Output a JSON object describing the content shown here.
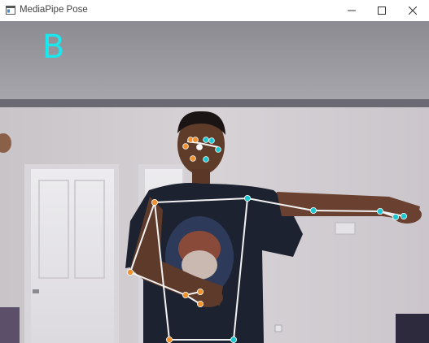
{
  "window": {
    "title": "MediaPipe Pose",
    "controls": {
      "minimize_icon": "minimize-icon",
      "maximize_icon": "maximize-icon",
      "close_icon": "close-icon"
    }
  },
  "frame": {
    "overlay_label": "B",
    "colors": {
      "overlay_label": "#19e8ef",
      "skeleton_line": "#f2f2f2",
      "landmark_left": "#f0912d",
      "landmark_right": "#1fc8d0"
    }
  }
}
